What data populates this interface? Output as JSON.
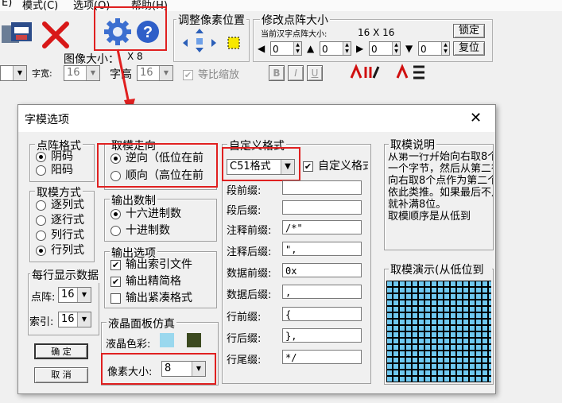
{
  "menu": {
    "items": [
      "E)",
      "模式(C)",
      "选项(O)",
      "帮助(H)"
    ]
  },
  "toolbar": {
    "image_size_label": "图像大小：",
    "image_size_value": "X 8",
    "font_label": "字宽:",
    "font_value": "16",
    "char_height_label": "字高",
    "char_height_value": "16",
    "equal_scale_label": "等比缩放",
    "adjust_group_title": "调整像素位置",
    "resize_group_title": "修改点阵大小",
    "current_font_label": "当前汉字点阵大小:",
    "current_font_value": "16 X 16",
    "lock_label": "锁定",
    "restore_label": "复位",
    "spin_values": [
      "0",
      "0",
      "0",
      "0"
    ],
    "style_buttons": [
      "B",
      "I",
      "U"
    ]
  },
  "dialog": {
    "title": "字模选项",
    "close_symbol": "✕",
    "dot_format": {
      "title": "点阵格式",
      "options": [
        "阴码",
        "阳码"
      ],
      "selected": 0
    },
    "scan_mode": {
      "title": "取模方式",
      "options": [
        "逐列式",
        "逐行式",
        "列行式",
        "行列式"
      ],
      "selected": 3
    },
    "per_line": {
      "title": "每行显示数据",
      "dot_label": "点阵:",
      "dot_value": "16",
      "index_label": "索引:",
      "index_value": "16"
    },
    "ok_label": "确 定",
    "cancel_label": "取 消",
    "direction": {
      "title": "取模走向",
      "options": [
        "逆向（低位在前",
        "顺向（高位在前"
      ],
      "selected": 0
    },
    "output_base": {
      "title": "输出数制",
      "options": [
        "十六进制数",
        "十进制数"
      ],
      "selected": 0
    },
    "output_options": {
      "title": "输出选项",
      "items": [
        {
          "label": "输出索引文件",
          "checked": true
        },
        {
          "label": "输出精简格",
          "checked": true
        },
        {
          "label": "输出紧凑格式",
          "checked": false
        }
      ]
    },
    "lcd": {
      "title": "液晶面板仿真",
      "color_label": "液晶色彩:",
      "pixel_label": "像素大小:",
      "pixel_value": "8",
      "colors": {
        "lcd_bg": "#9ad8ee",
        "lcd_fg": "#3c4a20"
      }
    },
    "custom_format": {
      "title": "自定义格式",
      "preset_value": "C51格式",
      "custom_checkbox_label": "自定义格式",
      "fields": [
        {
          "label": "段前缀:",
          "value": ""
        },
        {
          "label": "段后缀:",
          "value": ""
        },
        {
          "label": "注释前缀:",
          "value": "/*\""
        },
        {
          "label": "注释后缀:",
          "value": "\","
        },
        {
          "label": "数据前缀:",
          "value": "0x"
        },
        {
          "label": "数据后缀:",
          "value": ","
        },
        {
          "label": "行前缀:",
          "value": "{"
        },
        {
          "label": "行后缀:",
          "value": "},"
        },
        {
          "label": "行尾缀:",
          "value": "*/"
        }
      ]
    },
    "explanation": {
      "title": "取模说明",
      "text": "从第一行开始向右取8个点作为一个字节，然后从第二行开始向右取8个点作为第二个字节...依此类推。如果最后不足8个点就补满8位。\n取模顺序是从低到"
    },
    "demo": {
      "title": "取模演示(从低位到",
      "colors": {
        "cell": "#6ec8f0",
        "line": "#000000"
      }
    }
  },
  "colors": {
    "highlight": "#e02020",
    "dialog_bg": "#f0f0f0"
  }
}
